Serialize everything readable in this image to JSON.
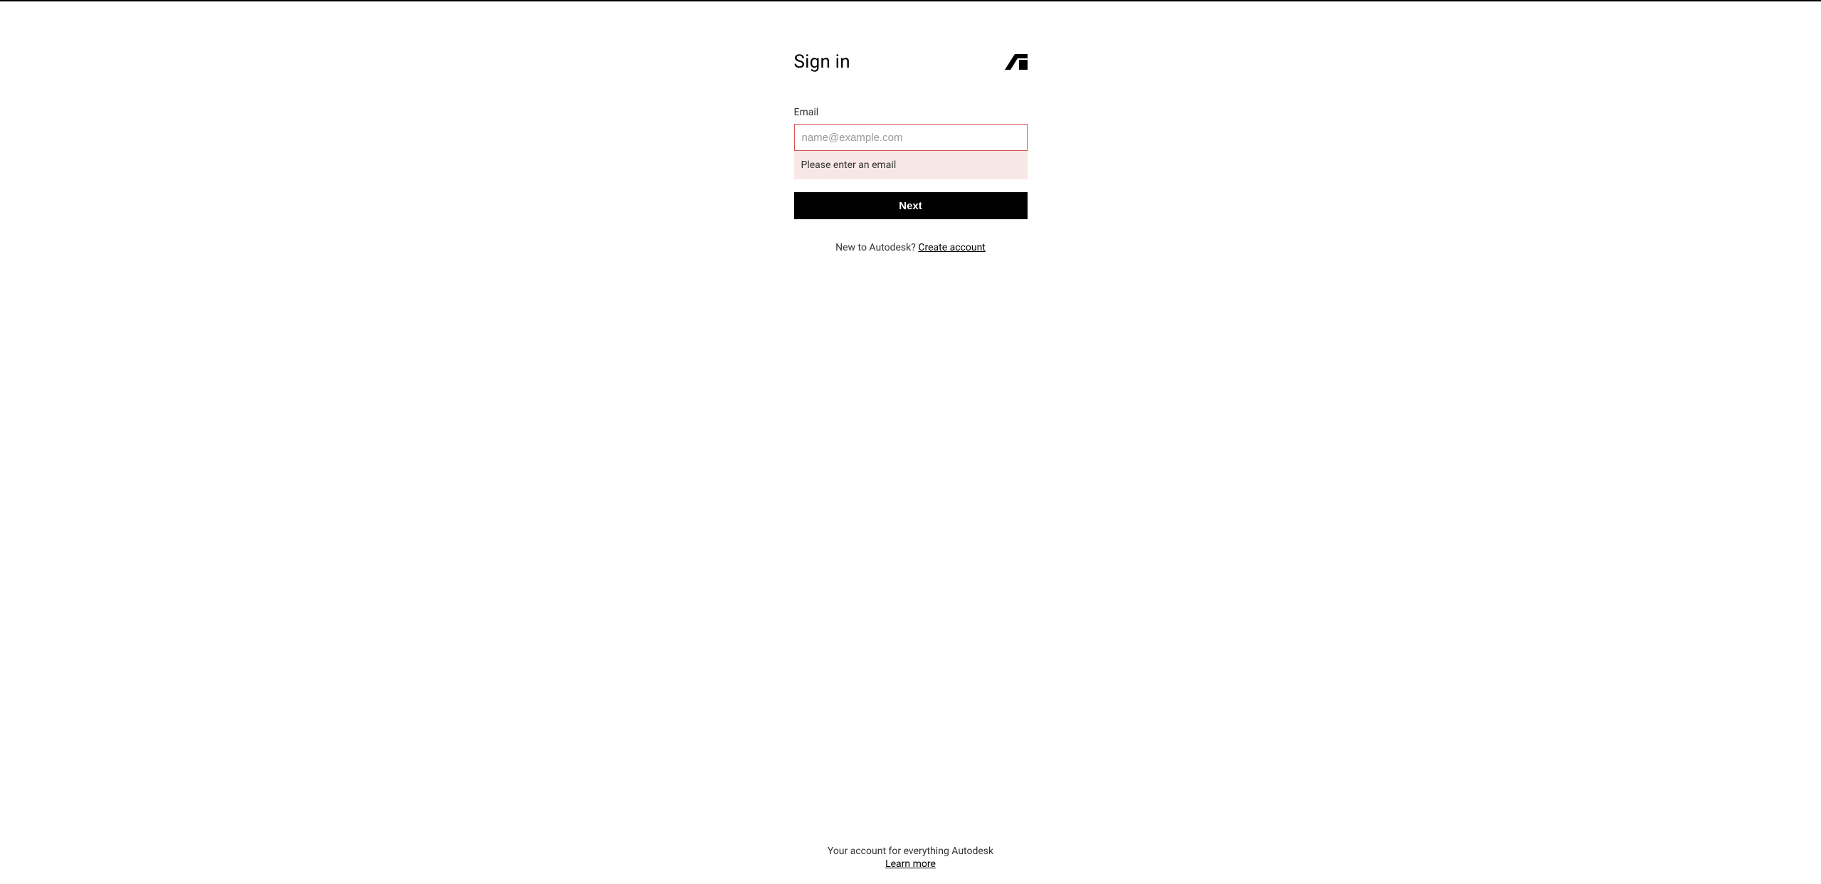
{
  "page": {
    "title": "Sign in"
  },
  "form": {
    "email_label": "Email",
    "email_placeholder": "name@example.com",
    "email_value": "",
    "error_message": "Please enter an email",
    "next_button": "Next"
  },
  "signup": {
    "prompt": "New to Autodesk? ",
    "link_text": "Create account"
  },
  "footer": {
    "tagline": "Your account for everything Autodesk",
    "learn_more": "Learn more"
  }
}
